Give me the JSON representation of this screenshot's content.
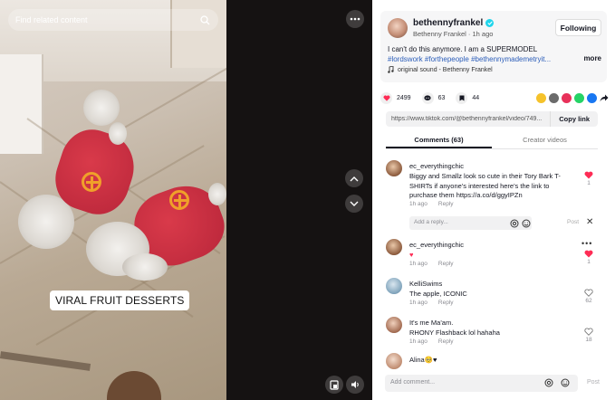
{
  "video": {
    "search_placeholder": "Find related content",
    "caption": "VIRAL FRUIT DESSERTS"
  },
  "creator": {
    "handle": "bethennyfrankel",
    "name": "Bethenny Frankel",
    "time_ago": "1h ago",
    "meta_separator": " · ",
    "follow_label": "Following",
    "description_text": "I can't do this anymore. I am a SUPERMODEL ",
    "hashtags": [
      "#lordswork",
      "#forthepeople",
      "#bethennymademetryit..."
    ],
    "more_label": "more",
    "sound": "original sound - Bethenny Frankel"
  },
  "stats": {
    "likes": "2499",
    "comments": "63",
    "saves": "44"
  },
  "share_colors": [
    "#f5c22b",
    "#6b6b6b",
    "#e8315a",
    "#25d366",
    "#1877f2"
  ],
  "link": {
    "url": "https://www.tiktok.com/@bethennyfrankel/video/749...",
    "copy_label": "Copy link"
  },
  "tabs": {
    "comments": "Comments (63)",
    "creator_videos": "Creator videos"
  },
  "comments": [
    {
      "user": "ec_everythingchic",
      "text": "Biggy and Smallz look so cute in their Tory Bark T-SHIRTs if anyone's interested here's the link to purchase them https://a.co/d/ggyIPZn",
      "time": "1h ago",
      "reply": "Reply",
      "likes": "1",
      "liked": true
    },
    {
      "user": "ec_everythingchic",
      "text": "♥",
      "time": "1h ago",
      "reply": "Reply",
      "likes": "1",
      "liked": true
    },
    {
      "user": "KelliSwims",
      "text": "The apple, ICONIC",
      "time": "1h ago",
      "reply": "Reply",
      "likes": "62",
      "liked": false
    },
    {
      "user": "It's me Ma'am.",
      "text": "RHONY Flashback lol hahaha",
      "time": "1h ago",
      "reply": "Reply",
      "likes": "18",
      "liked": false
    },
    {
      "user": "Alina🥺♥",
      "text": "",
      "time": "",
      "reply": "",
      "likes": "",
      "liked": false
    }
  ],
  "reply_box": {
    "placeholder": "Add a reply...",
    "post_label": "Post"
  },
  "add_comment": {
    "placeholder": "Add comment...",
    "post_label": "Post"
  },
  "colors": {
    "accent": "#fe2c55",
    "hashtag": "#2b5db9",
    "verified": "#20d5ec"
  }
}
